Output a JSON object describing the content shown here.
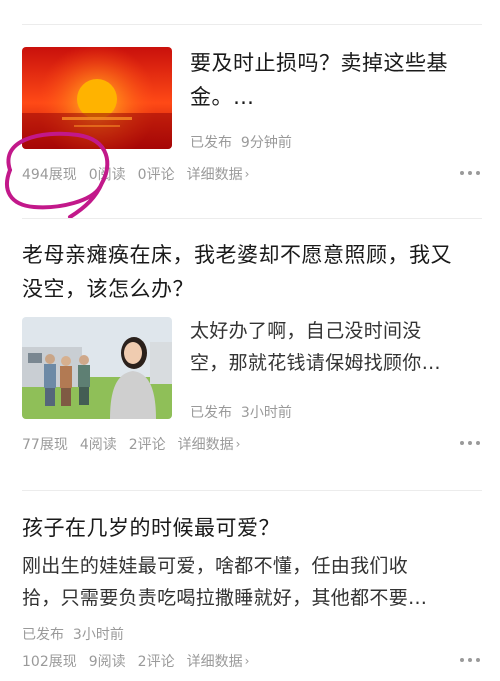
{
  "articles": [
    {
      "title_line1": "要及时止损吗？卖掉这些基",
      "title_line2": "金。…",
      "status": "已发布",
      "time": "9分钟前",
      "impressions": "494展现",
      "reads": "0阅读",
      "comments": "0评论",
      "detail": "详细数据"
    },
    {
      "title_line1": "老母亲瘫痪在床，我老婆却不愿意照顾，我又",
      "title_line2": "没空，该怎么办？",
      "excerpt_line1": "太好办了啊，自己没时间没",
      "excerpt_line2": "空，那就花钱请保姆找顾你…",
      "status": "已发布",
      "time": "3小时前",
      "impressions": "77展现",
      "reads": "4阅读",
      "comments": "2评论",
      "detail": "详细数据"
    },
    {
      "title_line1": "孩子在几岁的时候最可爱？",
      "excerpt_line1": "刚出生的娃娃最可爱，啥都不懂，任由我们收",
      "excerpt_line2": "拾，只需要负责吃喝拉撒睡就好，其他都不要…",
      "status": "已发布",
      "time": "3小时前",
      "impressions": "102展现",
      "reads": "9阅读",
      "comments": "2评论",
      "detail": "详细数据"
    }
  ],
  "colors": {
    "annotation": "#c2188a",
    "sun_sky": "#e8301a",
    "sun": "#ffb000"
  },
  "icons": {
    "more": "more-dots-icon",
    "chevron": "chevron-right-icon"
  }
}
